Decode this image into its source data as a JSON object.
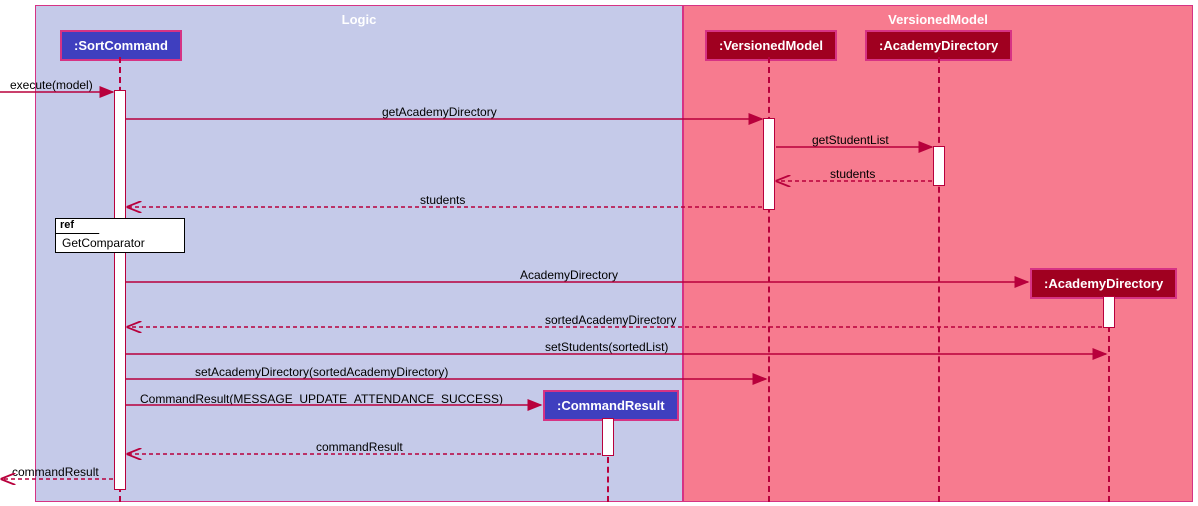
{
  "regions": {
    "logic": "Logic",
    "versioned": "VersionedModel"
  },
  "participants": {
    "sortCommand": ":SortCommand",
    "versionedModel": ":VersionedModel",
    "academyDirectory1": ":AcademyDirectory",
    "commandResult": ":CommandResult",
    "academyDirectory2": ":AcademyDirectory"
  },
  "messages": {
    "execute": "execute(model)",
    "getAcademyDirectory": "getAcademyDirectory",
    "getStudentList": "getStudentList",
    "students1": "students",
    "students2": "students",
    "academyDirectoryCreate": "AcademyDirectory",
    "sortedAcademyDirectory": "sortedAcademyDirectory",
    "setStudents": "setStudents(sortedList)",
    "setAcademyDirectory": "setAcademyDirectory(sortedAcademyDirectory)",
    "commandResultCreate": "CommandResult(MESSAGE_UPDATE_ATTENDANCE_SUCCESS)",
    "commandResultReturn": "commandResult",
    "commandResultOut": "commandResult"
  },
  "ref": {
    "label": "ref",
    "text": "GetComparator"
  }
}
